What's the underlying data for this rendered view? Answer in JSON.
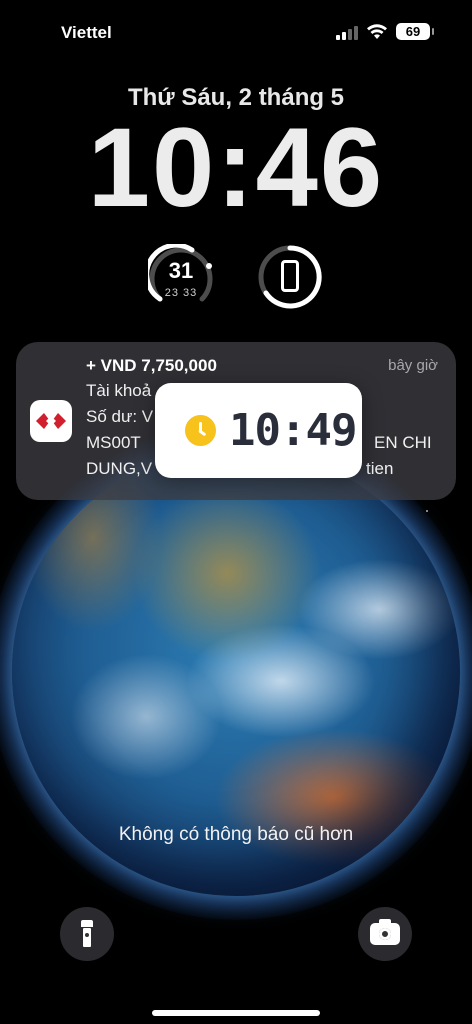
{
  "status_bar": {
    "carrier": "Viettel",
    "battery": "69"
  },
  "lock_screen": {
    "date": "Thứ Sáu, 2 tháng 5",
    "time": "10:46"
  },
  "widgets": {
    "weather": {
      "current": "31",
      "range": "23 33"
    },
    "battery_widget": {
      "icon": "phone-icon"
    }
  },
  "notification": {
    "app_icon": "bank-logo-icon",
    "title": "+ VND 7,750,000",
    "time": "bây giờ",
    "line1": "Tài khoả",
    "line2": "Số dư: V",
    "line3": "MS00T",
    "line3_tail": "EN CHI",
    "line4": "DUNG,V",
    "line4_tail": "tien"
  },
  "timer": {
    "value": "10:49",
    "icon": "clock-icon"
  },
  "footer": {
    "no_older_text": "Không có thông báo cũ hơn"
  },
  "colors": {
    "notification_bg": "#3c3c42",
    "timer_accent": "#f6c21b",
    "bank_red": "#d0202e"
  }
}
